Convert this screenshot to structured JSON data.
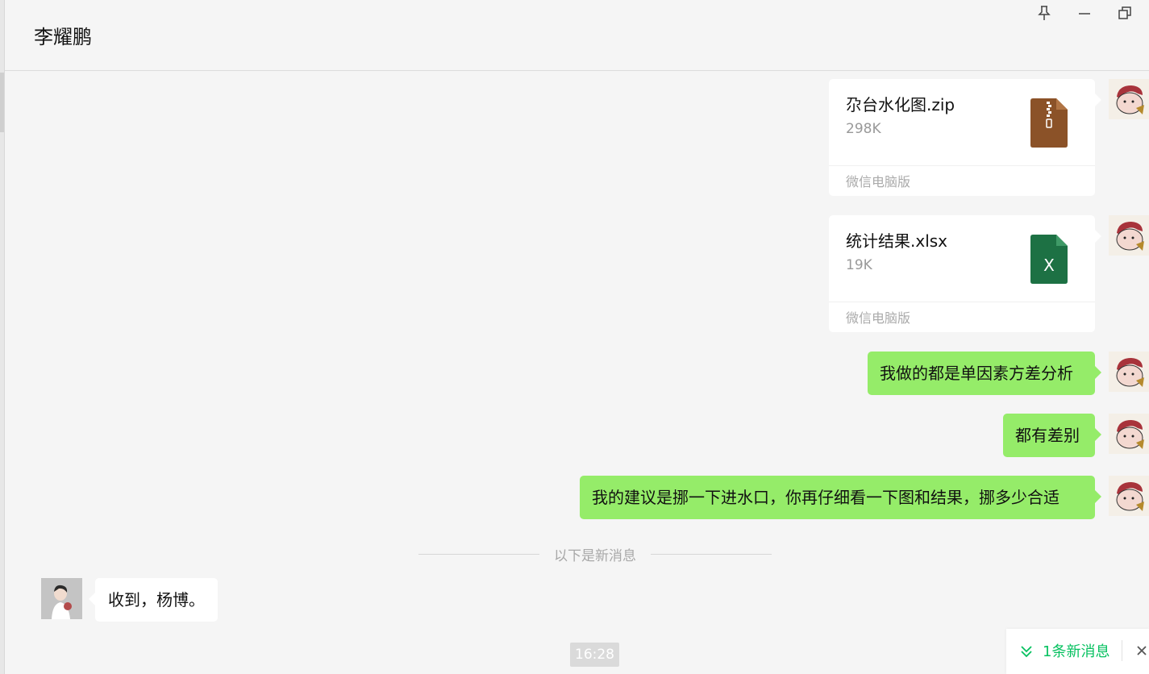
{
  "header": {
    "title": "李耀鹏"
  },
  "window_controls": [
    {
      "name": "pin-icon"
    },
    {
      "name": "minimize-icon"
    },
    {
      "name": "restore-icon"
    }
  ],
  "messages": {
    "file1": {
      "name": "尕台水化图.zip",
      "size": "298K",
      "source": "微信电脑版",
      "icon": "zip-file-icon"
    },
    "file2": {
      "name": "统计结果.xlsx",
      "size": "19K",
      "source": "微信电脑版",
      "icon": "excel-file-icon",
      "icon_letter": "X"
    },
    "text1": "我做的都是单因素方差分析",
    "text2": "都有差别",
    "text3": "我的建议是挪一下进水口，你再仔细看一下图和结果，挪多少合适",
    "divider": "以下是新消息",
    "reply": "收到，杨博。",
    "time": "16:28"
  },
  "new_message_bar": {
    "label": "1条新消息"
  },
  "colors": {
    "bubble_self": "#95ec69",
    "bubble_other": "#ffffff",
    "accent": "#07c160",
    "background": "#f5f5f5",
    "zip_icon": "#8b5228",
    "excel_icon": "#1d7144"
  }
}
